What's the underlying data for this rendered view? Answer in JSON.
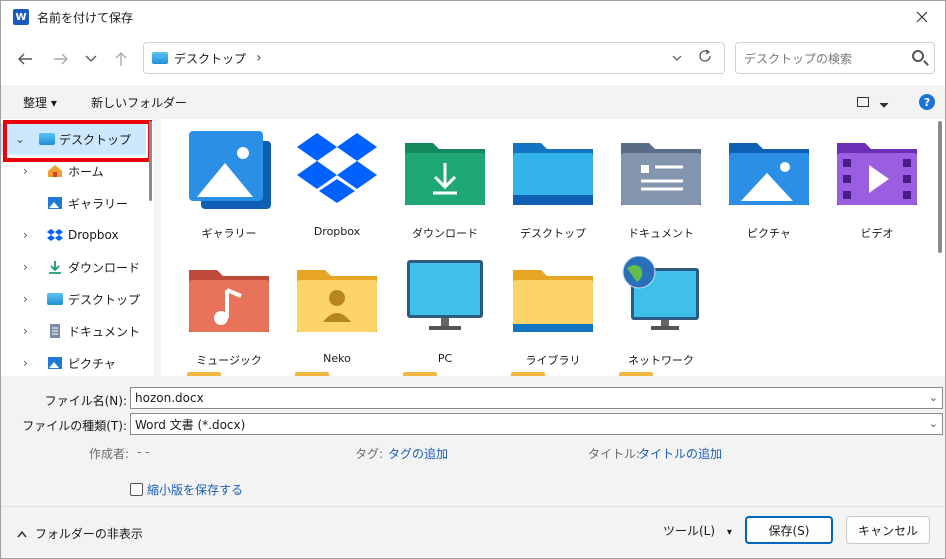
{
  "window": {
    "title": "名前を付けて保存",
    "app_icon": "word-icon",
    "app_letter": "W"
  },
  "address": {
    "path": "デスクトップ",
    "separator": "›"
  },
  "search": {
    "placeholder": "デスクトップの検索"
  },
  "toolbar": {
    "organize": "整理 ▾",
    "new_folder": "新しいフォルダー",
    "help": "?"
  },
  "sidebar": {
    "items": [
      {
        "label": "デスクトップ",
        "icon": "desktop-icon",
        "expanded": true,
        "selected": true
      },
      {
        "label": "ホーム",
        "icon": "home-icon",
        "expanded": false
      },
      {
        "label": "ギャラリー",
        "icon": "gallery-icon"
      },
      {
        "label": "Dropbox",
        "icon": "dropbox-icon",
        "expanded": false
      },
      {
        "label": "ダウンロード",
        "icon": "download-icon",
        "expanded": false
      },
      {
        "label": "デスクトップ",
        "icon": "desktop-icon",
        "expanded": false
      },
      {
        "label": "ドキュメント",
        "icon": "document-icon",
        "expanded": false
      },
      {
        "label": "ピクチャ",
        "icon": "pictures-icon",
        "expanded": false
      }
    ]
  },
  "files": [
    {
      "label": "ギャラリー",
      "icon": "gallery-icon"
    },
    {
      "label": "Dropbox",
      "icon": "dropbox-icon"
    },
    {
      "label": "ダウンロード",
      "icon": "download-folder-icon"
    },
    {
      "label": "デスクトップ",
      "icon": "desktop-folder-icon"
    },
    {
      "label": "ドキュメント",
      "icon": "documents-folder-icon"
    },
    {
      "label": "ピクチャ",
      "icon": "pictures-folder-icon"
    },
    {
      "label": "ビデオ",
      "icon": "videos-folder-icon"
    },
    {
      "label": "ミュージック",
      "icon": "music-folder-icon"
    },
    {
      "label": "Neko",
      "icon": "user-folder-icon"
    },
    {
      "label": "PC",
      "icon": "pc-icon"
    },
    {
      "label": "ライブラリ",
      "icon": "libraries-folder-icon"
    },
    {
      "label": "ネットワーク",
      "icon": "network-icon"
    }
  ],
  "form": {
    "filename_label": "ファイル名(N):",
    "filename_value": "hozon.docx",
    "filetype_label": "ファイルの種類(T):",
    "filetype_value": "Word 文書 (*.docx)",
    "author_label": "作成者:",
    "author_value": "- -",
    "tags_label": "タグ:",
    "tags_value": "タグの追加",
    "title_label": "タイトル:",
    "title_value": "タイトルの追加",
    "thumbnail_label": "縮小版を保存する"
  },
  "footer": {
    "hide_folders": "フォルダーの非表示",
    "tools": "ツール(L)",
    "save": "保存(S)",
    "cancel": "キャンセル"
  }
}
